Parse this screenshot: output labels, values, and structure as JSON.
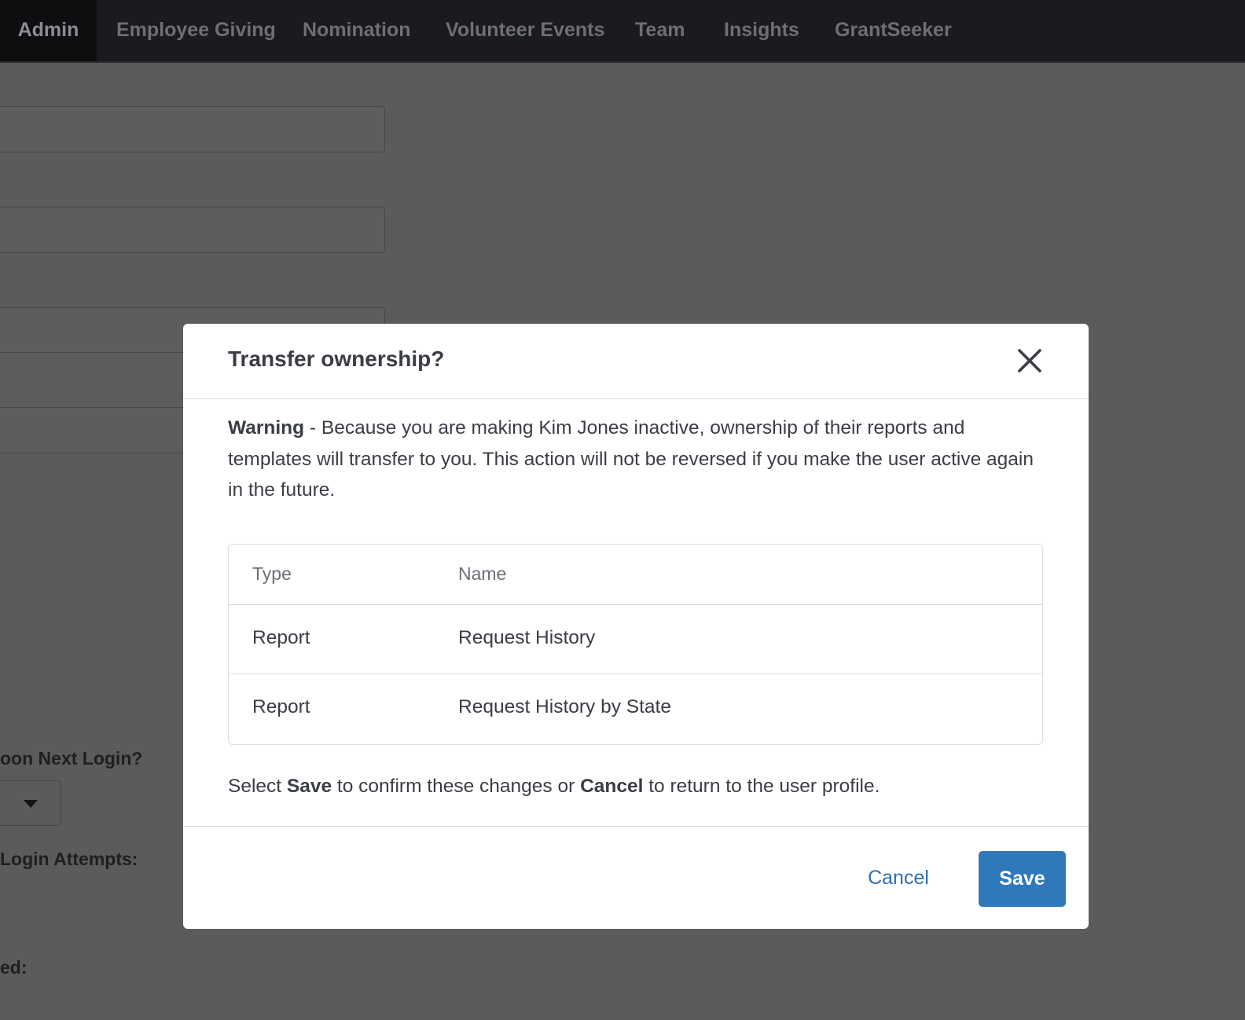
{
  "nav": {
    "tabs": [
      {
        "label": "Admin",
        "active": true
      },
      {
        "label": "Employee Giving",
        "active": false
      },
      {
        "label": "Nomination",
        "active": false
      },
      {
        "label": "Volunteer Events",
        "active": false
      },
      {
        "label": "Team",
        "active": false
      },
      {
        "label": "Insights",
        "active": false
      },
      {
        "label": "GrantSeeker",
        "active": false
      }
    ]
  },
  "background_form": {
    "labels": {
      "change_password": "oon Next Login?",
      "login_attempts": "Login Attempts:",
      "locked": "ed:"
    }
  },
  "modal": {
    "title": "Transfer ownership?",
    "close_icon": "close-icon",
    "warning": {
      "lead": "Warning",
      "text": " - Because you are making Kim Jones inactive, ownership of their reports and templates will transfer to you. This action will not be reversed if you make the user active again in the future."
    },
    "table": {
      "columns": [
        "Type",
        "Name"
      ],
      "rows": [
        {
          "type": "Report",
          "name": "Request History"
        },
        {
          "type": "Report",
          "name": "Request History by State"
        }
      ]
    },
    "instructions": {
      "part1": "Select ",
      "save_word": "Save",
      "part2": " to confirm these changes or ",
      "cancel_word": "Cancel",
      "part3": " to return to the user profile."
    },
    "buttons": {
      "cancel": "Cancel",
      "save": "Save"
    }
  },
  "colors": {
    "primary_button": "#2f79ba",
    "link": "#2e6fab",
    "overlay": "#5b5b5b",
    "nav_bg": "#1a1b1e"
  }
}
